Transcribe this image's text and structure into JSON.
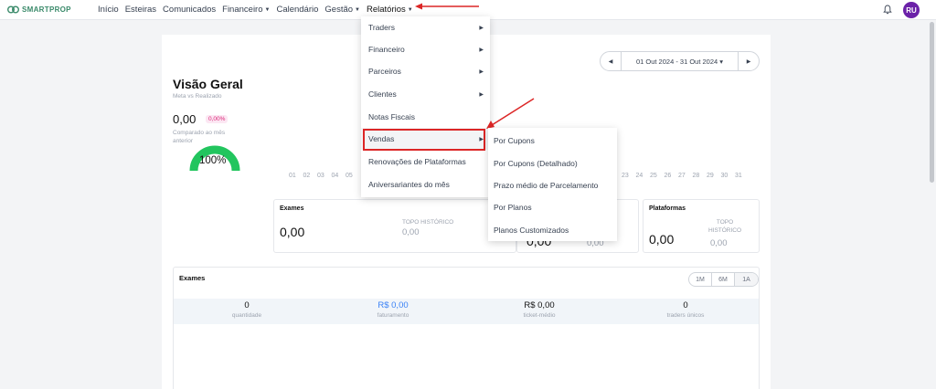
{
  "brand": {
    "name": "SMARTPROP"
  },
  "nav": {
    "items": [
      {
        "label": "Início",
        "caret": false
      },
      {
        "label": "Esteiras",
        "caret": false
      },
      {
        "label": "Comunicados",
        "caret": false
      },
      {
        "label": "Financeiro",
        "caret": true
      },
      {
        "label": "Calendário",
        "caret": false
      },
      {
        "label": "Gestão",
        "caret": true
      },
      {
        "label": "Relatórios",
        "caret": true
      }
    ],
    "avatar_initials": "RU"
  },
  "overview": {
    "title": "Visão Geral",
    "subtitle": "Meta vs Realizado",
    "value": "0,00",
    "badge": "0,00%",
    "compare_text": "Comparado ao mês anterior",
    "gauge_label": "100%",
    "gauge_color": "#22c55e"
  },
  "date_range": {
    "label": "01 Out 2024 - 31 Out 2024"
  },
  "days_left": [
    "01",
    "02",
    "03",
    "04",
    "05"
  ],
  "days_right": [
    "23",
    "24",
    "25",
    "26",
    "27",
    "28",
    "29",
    "30",
    "31"
  ],
  "stats": [
    {
      "title": "Exames",
      "value": "0,00",
      "hist_label": "TOPO HISTÓRICO",
      "hist_value": "0,00"
    },
    {
      "title": "",
      "value": "0,00",
      "hist_label": "",
      "hist_value": "0,00"
    },
    {
      "title": "Plataformas",
      "value": "0,00",
      "hist_label": "TOPO HISTÓRICO",
      "hist_value": "0,00"
    }
  ],
  "menu": {
    "items": [
      {
        "label": "Traders",
        "arrow": true
      },
      {
        "label": "Financeiro",
        "arrow": true
      },
      {
        "label": "Parceiros",
        "arrow": true
      },
      {
        "label": "Clientes",
        "arrow": true
      },
      {
        "label": "Notas Fiscais",
        "arrow": false
      },
      {
        "label": "Vendas",
        "arrow": true
      },
      {
        "label": "Renovações de Plataformas",
        "arrow": false
      },
      {
        "label": "Aniversariantes do mês",
        "arrow": false
      }
    ],
    "submenu": [
      "Por Cupons",
      "Por Cupons (Detalhado)",
      "Prazo médio de Parcelamento",
      "Por Planos",
      "Planos Customizados"
    ]
  },
  "exames_panel": {
    "title": "Exames",
    "periods": [
      "1M",
      "6M",
      "1A"
    ],
    "metrics": [
      {
        "value": "0",
        "label": "quantidade"
      },
      {
        "value": "R$ 0,00",
        "label": "faturamento"
      },
      {
        "value": "R$ 0,00",
        "label": "ticket-médio"
      },
      {
        "value": "0",
        "label": "traders únicos"
      }
    ]
  },
  "colors": {
    "accent": "#3b82f6",
    "highlight": "#dc2626",
    "avatar": "#6b21a8"
  }
}
